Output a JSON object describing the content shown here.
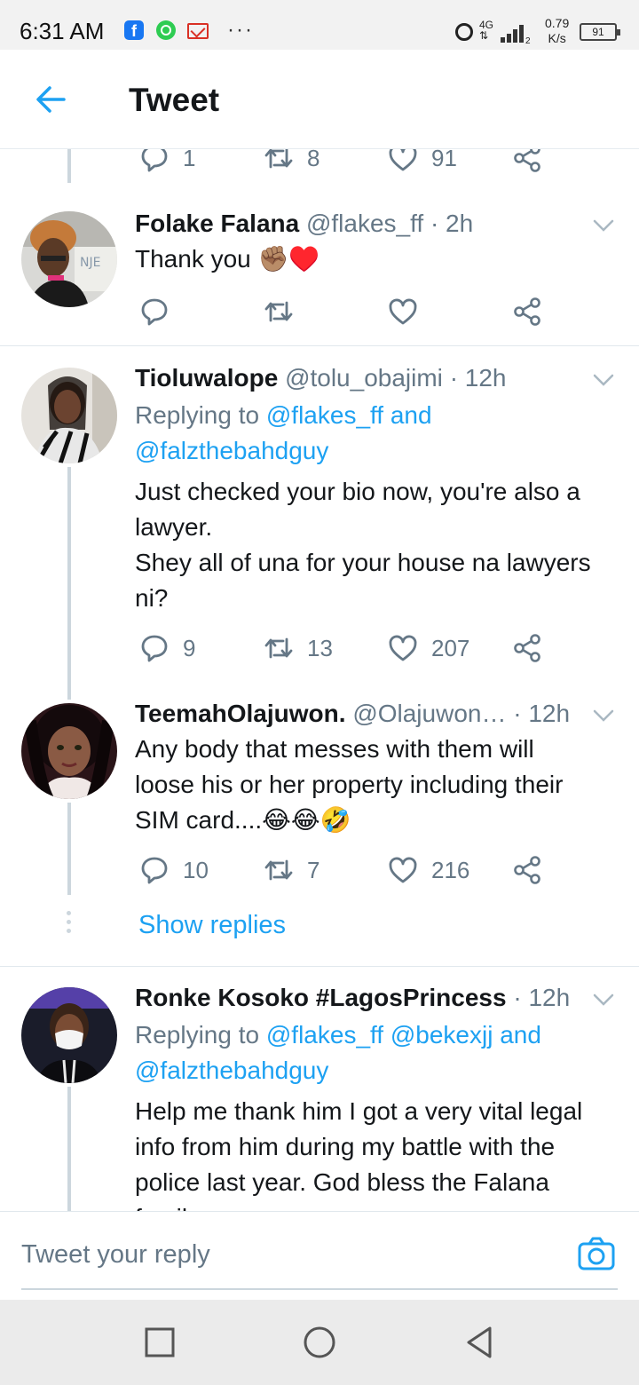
{
  "status_bar": {
    "time": "6:31 AM",
    "network": "4G",
    "sim": "2",
    "speed_value": "0.79",
    "speed_unit": "K/s",
    "battery": "91",
    "overflow": "···"
  },
  "header": {
    "title": "Tweet",
    "back_icon": "arrow-left-icon"
  },
  "top_actions": {
    "replies": "1",
    "retweets": "8",
    "likes": "91"
  },
  "tweets": [
    {
      "name": "Folake Falana",
      "handle": "@flakes_ff",
      "time": "· 2h",
      "text": "Thank you ✊🏽♥️",
      "replies": "",
      "retweets": "",
      "likes": ""
    },
    {
      "name": "Tioluwalope",
      "handle": "@tolu_obajimi",
      "time": "· 12h",
      "replying_prefix": "Replying to ",
      "replying_users": "@flakes_ff and\n@falzthebahdguy",
      "text": "Just checked your bio now, you're also a\nlawyer.\nShey all of una for your house na lawyers\nni?",
      "replies": "9",
      "retweets": "13",
      "likes": "207"
    },
    {
      "name": "TeemahOlajuwon.",
      "handle": "@Olajuwon…",
      "time": "· 12h",
      "text": "Any body that messes with them will\nloose his or her property including their\nSIM card....😂😂🤣",
      "replies": "10",
      "retweets": "7",
      "likes": "216"
    },
    {
      "name": "Ronke Kosoko #LagosPrincess",
      "handle": "",
      "time": "· 12h",
      "replying_prefix": "Replying to ",
      "replying_users": "@flakes_ff @bekexjj and\n@falzthebahdguy",
      "text": "Help me thank him I got a very vital legal\ninfo from him during my battle with the\npolice last year. God bless the Falana\nfamily"
    }
  ],
  "show_replies": "Show replies",
  "reply_bar": {
    "placeholder": "Tweet your reply",
    "camera_icon": "camera-icon"
  },
  "colors": {
    "link": "#1da1f2",
    "secondary_text": "#657786",
    "primary_text": "#14171a",
    "heart": "#c8102e"
  }
}
